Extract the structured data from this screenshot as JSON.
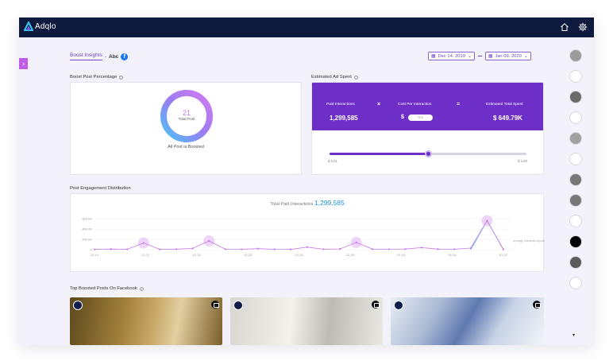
{
  "app": {
    "name": "Adqlo",
    "top_icons": [
      "home-icon",
      "gear-icon"
    ]
  },
  "breadcrumb": {
    "link": "Boost Insights",
    "separator": "-",
    "page": "Abc",
    "badge": "f"
  },
  "date_range": {
    "start": "Dec 14, 2019",
    "end": "Jan 09, 2020"
  },
  "boost_post_percentage": {
    "title": "Boost Post Percentage",
    "total_value": "21",
    "total_label": "Total Post",
    "note": "All Post is Boosted",
    "boosted_fraction": 1.0,
    "colors": [
      "#4cc3f5",
      "#9b7cf0",
      "#d37af0"
    ]
  },
  "estimated_ad_spent": {
    "title": "Estimated Ad Spent",
    "paid_label": "Paid Interactions",
    "paid_value": "1,299,585",
    "cost_label": "Cost Per Interaction",
    "cost_currency": "$",
    "cost_input": "0.5",
    "total_label": "Estimated Total Spent",
    "total_value": "$ 649.79K",
    "op_multiply": "×",
    "op_equals": "=",
    "slider_min": "$ 0.01",
    "slider_max": "$ 1.00",
    "slider_value": 0.5,
    "accent": "#6e2fc9"
  },
  "engagement": {
    "title": "Post Engagement Distribution",
    "chart_title_prefix": "Total Paid Interactions",
    "chart_title_value": "1,299,585"
  },
  "chart_data": {
    "type": "line",
    "x_ticks": [
      "12-14",
      "12-17",
      "12-20",
      "12-23",
      "12-26",
      "12-29",
      "01-01",
      "01-04",
      "01-07"
    ],
    "y_ticks": [
      "600.0K",
      "400.0K",
      "200.0K",
      "0"
    ],
    "ylim": [
      0,
      600000
    ],
    "series": [
      {
        "color": "#c77ae8",
        "values": [
          5000,
          12000,
          8000,
          130000,
          6000,
          10000,
          25000,
          170000,
          9000,
          7000,
          20000,
          8000,
          6000,
          50000,
          9000,
          14000,
          140000,
          10000,
          9000,
          12000,
          40000,
          11000,
          9000,
          30000,
          560000,
          6000
        ]
      }
    ],
    "highlights": [
      3,
      7,
      16,
      24
    ],
    "avg_label": "average interactions/post"
  },
  "top_posts": {
    "title": "Top Boosted Posts On Facebook"
  },
  "brands": [
    {
      "name": "brand-1-icon",
      "color": "#9c9c9c"
    },
    {
      "name": "brand-2-icon",
      "color": "#ffffff"
    },
    {
      "name": "brand-3-icon",
      "color": "#6a6a6a"
    },
    {
      "name": "brand-4-icon",
      "color": "#ffffff"
    },
    {
      "name": "brand-5-icon",
      "color": "#a0a0a0"
    },
    {
      "name": "brand-6-icon",
      "color": "#ffffff"
    },
    {
      "name": "brand-7-icon",
      "color": "#777777"
    },
    {
      "name": "brand-8-icon",
      "color": "#777777"
    },
    {
      "name": "brand-9-icon",
      "color": "#ffffff"
    },
    {
      "name": "brand-10-icon",
      "color": "#000000"
    },
    {
      "name": "brand-11-icon",
      "color": "#5c5c5c"
    },
    {
      "name": "brand-12-icon",
      "color": "#ffffff"
    }
  ]
}
